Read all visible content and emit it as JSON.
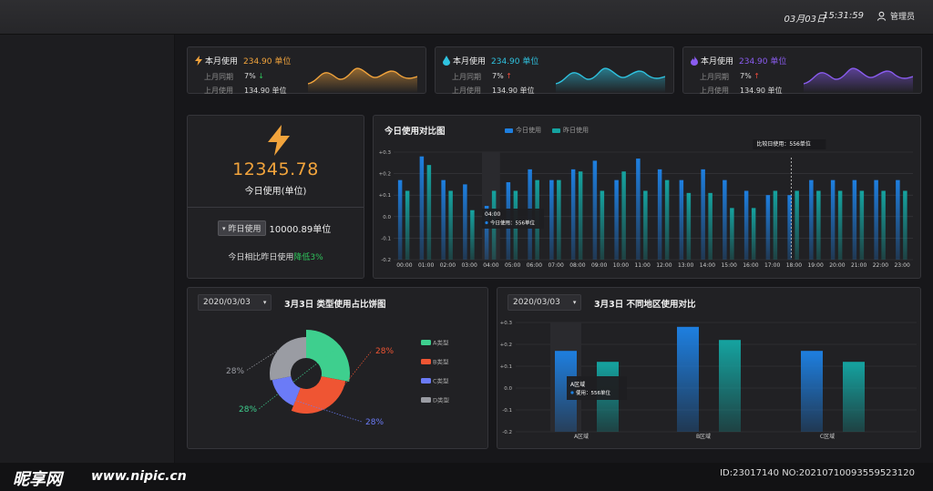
{
  "header": {
    "date": "03月03日",
    "time": "15:31:59",
    "user_label": "管理员"
  },
  "stat_cards": [
    {
      "title": "本月使用",
      "value": "234.90 单位",
      "accent": "#f2a43c",
      "icon": "lightning-icon",
      "yoy_label": "上月同期",
      "yoy_value": "7%",
      "yoy_dir": "down",
      "prev_label": "上月使用",
      "prev_value": "134.90 单位"
    },
    {
      "title": "本月使用",
      "value": "234.90 单位",
      "accent": "#2fc3e0",
      "icon": "water-drop-icon",
      "yoy_label": "上月同期",
      "yoy_value": "7%",
      "yoy_dir": "up",
      "prev_label": "上月使用",
      "prev_value": "134.90 单位"
    },
    {
      "title": "本月使用",
      "value": "234.90 单位",
      "accent": "#8a5cf0",
      "icon": "flame-icon",
      "yoy_label": "上月同期",
      "yoy_value": "7%",
      "yoy_dir": "up",
      "prev_label": "上月使用",
      "prev_value": "134.90 单位"
    }
  ],
  "today": {
    "value": "12345.78",
    "label": "今日使用(单位)",
    "compare_select": "昨日使用",
    "compare_value": "10000.89单位",
    "summary_prefix": "今日相比昨日使用",
    "summary_change": "降低3%"
  },
  "chart_data": [
    {
      "type": "bar",
      "title": "今日使用对比图",
      "categories": [
        "00:00",
        "01:00",
        "02:00",
        "03:00",
        "04:00",
        "05:00",
        "06:00",
        "07:00",
        "08:00",
        "09:00",
        "10:00",
        "11:00",
        "12:00",
        "13:00",
        "14:00",
        "15:00",
        "16:00",
        "17:00",
        "18:00",
        "19:00",
        "20:00",
        "21:00",
        "22:00",
        "23:00"
      ],
      "series": [
        {
          "name": "今日使用",
          "color": "#1e7fe0",
          "values": [
            0.17,
            0.28,
            0.17,
            0.15,
            0.05,
            0.16,
            0.22,
            0.17,
            0.22,
            0.26,
            0.17,
            0.27,
            0.22,
            0.17,
            0.22,
            0.17,
            0.12,
            0.1,
            0.1,
            0.17,
            0.17,
            0.17,
            0.17,
            0.17
          ]
        },
        {
          "name": "昨日使用",
          "color": "#15a3a0",
          "values": [
            0.12,
            0.24,
            0.12,
            0.03,
            0.12,
            0.12,
            0.17,
            0.17,
            0.21,
            0.12,
            0.21,
            0.12,
            0.17,
            0.11,
            0.11,
            0.04,
            0.04,
            0.12,
            0.12,
            0.12,
            0.12,
            0.12,
            0.12,
            0.12
          ]
        }
      ],
      "ylim": [
        -0.2,
        0.3
      ],
      "yticks": [
        "+0.3",
        "+0.2",
        "+0.1",
        "0.0",
        "-0.1",
        "-0.2"
      ],
      "tooltip": {
        "time": "04:00",
        "text": "今日使用：556单位"
      },
      "marker_label": "比较日使用：556单位"
    },
    {
      "type": "pie",
      "title": "3月3日 类型使用占比饼图",
      "date": "2020/03/03",
      "slices": [
        {
          "name": "A类型",
          "value": 28,
          "label": "28%",
          "color": "#3ecf8e"
        },
        {
          "name": "B类型",
          "value": 28,
          "label": "28%",
          "color": "#ef5533"
        },
        {
          "name": "C类型",
          "value": 16,
          "label": "28%",
          "color": "#6b7bf7"
        },
        {
          "name": "D类型",
          "value": 28,
          "label": "28%",
          "color": "#9a9ca3"
        }
      ]
    },
    {
      "type": "bar",
      "title": "3月3日 不同地区使用对比",
      "date": "2020/03/03",
      "categories": [
        "A区域",
        "B区域",
        "C区域"
      ],
      "series": [
        {
          "name": "",
          "color": "#1e7fe0",
          "values": [
            0.17,
            0.28,
            0.17
          ]
        },
        {
          "name": "",
          "color": "#15a3a0",
          "values": [
            0.12,
            0.22,
            0.12
          ]
        }
      ],
      "ylim": [
        -0.2,
        0.3
      ],
      "yticks": [
        "+0.3",
        "+0.2",
        "+0.1",
        "0.0",
        "-0.1",
        "-0.2"
      ],
      "tooltip": {
        "title": "A区域",
        "text": "使用：556单位"
      }
    }
  ],
  "watermark": {
    "logo": "昵享网",
    "url": "www.nipic.cn",
    "id": "ID:23017140 NO:20210710093559523120"
  }
}
